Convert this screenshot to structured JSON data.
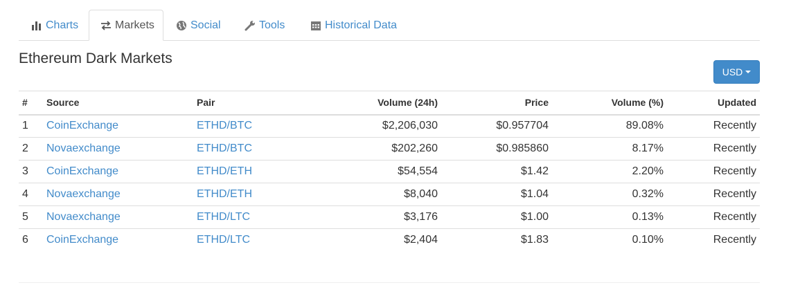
{
  "tabs": [
    {
      "label": "Charts",
      "icon": "bar-chart-icon",
      "active": false
    },
    {
      "label": "Markets",
      "icon": "transfer-arrows-icon",
      "active": true
    },
    {
      "label": "Social",
      "icon": "globe-icon",
      "active": false
    },
    {
      "label": "Tools",
      "icon": "wrench-icon",
      "active": false
    },
    {
      "label": "Historical Data",
      "icon": "calendar-icon",
      "active": false
    }
  ],
  "page_title": "Ethereum Dark Markets",
  "currency_button": {
    "label": "USD"
  },
  "colors": {
    "link": "#428bca",
    "primary_button": "#428bca",
    "text": "#333333",
    "border": "#dddddd"
  },
  "table": {
    "headers": {
      "num": "#",
      "source": "Source",
      "pair": "Pair",
      "volume": "Volume (24h)",
      "price": "Price",
      "volume_pct": "Volume (%)",
      "updated": "Updated"
    },
    "rows": [
      {
        "num": "1",
        "source": "CoinExchange",
        "pair": "ETHD/BTC",
        "volume": "$2,206,030",
        "price": "$0.957704",
        "volume_pct": "89.08%",
        "updated": "Recently"
      },
      {
        "num": "2",
        "source": "Novaexchange",
        "pair": "ETHD/BTC",
        "volume": "$202,260",
        "price": "$0.985860",
        "volume_pct": "8.17%",
        "updated": "Recently"
      },
      {
        "num": "3",
        "source": "CoinExchange",
        "pair": "ETHD/ETH",
        "volume": "$54,554",
        "price": "$1.42",
        "volume_pct": "2.20%",
        "updated": "Recently"
      },
      {
        "num": "4",
        "source": "Novaexchange",
        "pair": "ETHD/ETH",
        "volume": "$8,040",
        "price": "$1.04",
        "volume_pct": "0.32%",
        "updated": "Recently"
      },
      {
        "num": "5",
        "source": "Novaexchange",
        "pair": "ETHD/LTC",
        "volume": "$3,176",
        "price": "$1.00",
        "volume_pct": "0.13%",
        "updated": "Recently"
      },
      {
        "num": "6",
        "source": "CoinExchange",
        "pair": "ETHD/LTC",
        "volume": "$2,404",
        "price": "$1.83",
        "volume_pct": "0.10%",
        "updated": "Recently"
      }
    ]
  }
}
